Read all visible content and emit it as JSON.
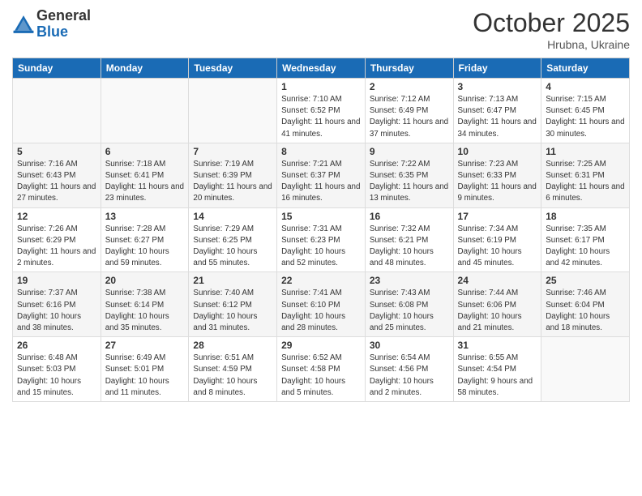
{
  "logo": {
    "general": "General",
    "blue": "Blue"
  },
  "title": "October 2025",
  "location": "Hrubna, Ukraine",
  "days_of_week": [
    "Sunday",
    "Monday",
    "Tuesday",
    "Wednesday",
    "Thursday",
    "Friday",
    "Saturday"
  ],
  "weeks": [
    [
      {
        "day": "",
        "info": ""
      },
      {
        "day": "",
        "info": ""
      },
      {
        "day": "",
        "info": ""
      },
      {
        "day": "1",
        "info": "Sunrise: 7:10 AM\nSunset: 6:52 PM\nDaylight: 11 hours\nand 41 minutes."
      },
      {
        "day": "2",
        "info": "Sunrise: 7:12 AM\nSunset: 6:49 PM\nDaylight: 11 hours\nand 37 minutes."
      },
      {
        "day": "3",
        "info": "Sunrise: 7:13 AM\nSunset: 6:47 PM\nDaylight: 11 hours\nand 34 minutes."
      },
      {
        "day": "4",
        "info": "Sunrise: 7:15 AM\nSunset: 6:45 PM\nDaylight: 11 hours\nand 30 minutes."
      }
    ],
    [
      {
        "day": "5",
        "info": "Sunrise: 7:16 AM\nSunset: 6:43 PM\nDaylight: 11 hours\nand 27 minutes."
      },
      {
        "day": "6",
        "info": "Sunrise: 7:18 AM\nSunset: 6:41 PM\nDaylight: 11 hours\nand 23 minutes."
      },
      {
        "day": "7",
        "info": "Sunrise: 7:19 AM\nSunset: 6:39 PM\nDaylight: 11 hours\nand 20 minutes."
      },
      {
        "day": "8",
        "info": "Sunrise: 7:21 AM\nSunset: 6:37 PM\nDaylight: 11 hours\nand 16 minutes."
      },
      {
        "day": "9",
        "info": "Sunrise: 7:22 AM\nSunset: 6:35 PM\nDaylight: 11 hours\nand 13 minutes."
      },
      {
        "day": "10",
        "info": "Sunrise: 7:23 AM\nSunset: 6:33 PM\nDaylight: 11 hours\nand 9 minutes."
      },
      {
        "day": "11",
        "info": "Sunrise: 7:25 AM\nSunset: 6:31 PM\nDaylight: 11 hours\nand 6 minutes."
      }
    ],
    [
      {
        "day": "12",
        "info": "Sunrise: 7:26 AM\nSunset: 6:29 PM\nDaylight: 11 hours\nand 2 minutes."
      },
      {
        "day": "13",
        "info": "Sunrise: 7:28 AM\nSunset: 6:27 PM\nDaylight: 10 hours\nand 59 minutes."
      },
      {
        "day": "14",
        "info": "Sunrise: 7:29 AM\nSunset: 6:25 PM\nDaylight: 10 hours\nand 55 minutes."
      },
      {
        "day": "15",
        "info": "Sunrise: 7:31 AM\nSunset: 6:23 PM\nDaylight: 10 hours\nand 52 minutes."
      },
      {
        "day": "16",
        "info": "Sunrise: 7:32 AM\nSunset: 6:21 PM\nDaylight: 10 hours\nand 48 minutes."
      },
      {
        "day": "17",
        "info": "Sunrise: 7:34 AM\nSunset: 6:19 PM\nDaylight: 10 hours\nand 45 minutes."
      },
      {
        "day": "18",
        "info": "Sunrise: 7:35 AM\nSunset: 6:17 PM\nDaylight: 10 hours\nand 42 minutes."
      }
    ],
    [
      {
        "day": "19",
        "info": "Sunrise: 7:37 AM\nSunset: 6:16 PM\nDaylight: 10 hours\nand 38 minutes."
      },
      {
        "day": "20",
        "info": "Sunrise: 7:38 AM\nSunset: 6:14 PM\nDaylight: 10 hours\nand 35 minutes."
      },
      {
        "day": "21",
        "info": "Sunrise: 7:40 AM\nSunset: 6:12 PM\nDaylight: 10 hours\nand 31 minutes."
      },
      {
        "day": "22",
        "info": "Sunrise: 7:41 AM\nSunset: 6:10 PM\nDaylight: 10 hours\nand 28 minutes."
      },
      {
        "day": "23",
        "info": "Sunrise: 7:43 AM\nSunset: 6:08 PM\nDaylight: 10 hours\nand 25 minutes."
      },
      {
        "day": "24",
        "info": "Sunrise: 7:44 AM\nSunset: 6:06 PM\nDaylight: 10 hours\nand 21 minutes."
      },
      {
        "day": "25",
        "info": "Sunrise: 7:46 AM\nSunset: 6:04 PM\nDaylight: 10 hours\nand 18 minutes."
      }
    ],
    [
      {
        "day": "26",
        "info": "Sunrise: 6:48 AM\nSunset: 5:03 PM\nDaylight: 10 hours\nand 15 minutes."
      },
      {
        "day": "27",
        "info": "Sunrise: 6:49 AM\nSunset: 5:01 PM\nDaylight: 10 hours\nand 11 minutes."
      },
      {
        "day": "28",
        "info": "Sunrise: 6:51 AM\nSunset: 4:59 PM\nDaylight: 10 hours\nand 8 minutes."
      },
      {
        "day": "29",
        "info": "Sunrise: 6:52 AM\nSunset: 4:58 PM\nDaylight: 10 hours\nand 5 minutes."
      },
      {
        "day": "30",
        "info": "Sunrise: 6:54 AM\nSunset: 4:56 PM\nDaylight: 10 hours\nand 2 minutes."
      },
      {
        "day": "31",
        "info": "Sunrise: 6:55 AM\nSunset: 4:54 PM\nDaylight: 9 hours\nand 58 minutes."
      },
      {
        "day": "",
        "info": ""
      }
    ]
  ]
}
